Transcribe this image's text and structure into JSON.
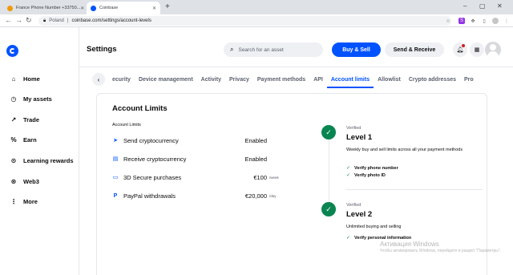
{
  "browser": {
    "tabs": [
      {
        "title": "France Phone Number +33750...",
        "favicon_color": "#f29900"
      },
      {
        "title": "Coinbase",
        "favicon_color": "#0052ff"
      }
    ],
    "new_tab": "+",
    "url_region": "Poland",
    "url": "coinbase.com/settings/account-levels"
  },
  "sidebar": {
    "items": [
      {
        "label": "Home",
        "icon": "home-icon",
        "glyph": "⌂"
      },
      {
        "label": "My assets",
        "icon": "clock-icon",
        "glyph": "◷"
      },
      {
        "label": "Trade",
        "icon": "trend-icon",
        "glyph": "↗"
      },
      {
        "label": "Earn",
        "icon": "percent-icon",
        "glyph": "%"
      },
      {
        "label": "Learning rewards",
        "icon": "learn-icon",
        "glyph": "⊙"
      },
      {
        "label": "Web3",
        "icon": "web3-icon",
        "glyph": "⊛"
      },
      {
        "label": "More",
        "icon": "more-icon",
        "glyph": "⋮"
      }
    ]
  },
  "header": {
    "title": "Settings",
    "search_placeholder": "Search for an asset",
    "buy_sell": "Buy & Sell",
    "send_receive": "Send & Receive"
  },
  "settings_tabs": {
    "items": [
      "ecurity",
      "Device management",
      "Activity",
      "Privacy",
      "Payment methods",
      "API",
      "Account limits",
      "Allowlist",
      "Crypto addresses",
      "Pro"
    ],
    "active": "Account limits"
  },
  "limits": {
    "title": "Account Limits",
    "subtitle": "Account Limits",
    "rows": [
      {
        "label": "Send cryptocurrency",
        "value": "Enabled",
        "unit": "",
        "icon": "send-icon",
        "glyph": "➤"
      },
      {
        "label": "Receive cryptocurrency",
        "value": "Enabled",
        "unit": "",
        "icon": "receive-icon",
        "glyph": "▤"
      },
      {
        "label": "3D Secure purchases",
        "value": "€100",
        "unit": "/week",
        "icon": "card-icon",
        "glyph": "▭"
      },
      {
        "label": "PayPal withdrawals",
        "value": "€20,000",
        "unit": "/day",
        "icon": "paypal-icon",
        "glyph": "P"
      }
    ]
  },
  "levels": [
    {
      "badge": "Verified",
      "title": "Level 1",
      "desc": "Weekly buy and sell limits across all your payment methods",
      "items": [
        "Verify phone number",
        "Verify photo ID"
      ]
    },
    {
      "badge": "Verified",
      "title": "Level 2",
      "desc": "Unlimited buying and selling",
      "items": [
        "Verify personal information"
      ]
    }
  ],
  "watermark": {
    "line1": "Активация Windows",
    "line2": "Чтобы активировать Windows, перейдите в раздел \"Параметры\"."
  }
}
